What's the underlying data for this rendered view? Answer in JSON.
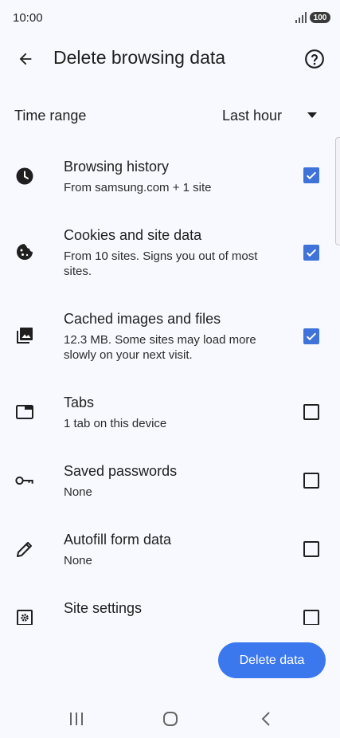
{
  "status_bar": {
    "time": "10:00",
    "battery": "100",
    "icons": [
      "signal-icon",
      "battery-icon"
    ]
  },
  "app_bar": {
    "title": "Delete browsing data",
    "icons": [
      "back-arrow-icon",
      "help-icon"
    ]
  },
  "time_range": {
    "label": "Time range",
    "value": "Last hour"
  },
  "options": [
    {
      "title": "Browsing history",
      "desc": "From samsung.com + 1 site",
      "checked": true,
      "icon": "clock-icon"
    },
    {
      "title": "Cookies and site data",
      "desc": "From 10 sites. Signs you out of most sites.",
      "checked": true,
      "icon": "cookie-icon"
    },
    {
      "title": "Cached images and files",
      "desc": "12.3 MB. Some sites may load more slowly on your next visit.",
      "checked": true,
      "icon": "images-icon"
    },
    {
      "title": "Tabs",
      "desc": "1 tab on this device",
      "checked": false,
      "icon": "tab-icon"
    },
    {
      "title": "Saved passwords",
      "desc": "None",
      "checked": false,
      "icon": "key-icon"
    },
    {
      "title": "Autofill form data",
      "desc": "None",
      "checked": false,
      "icon": "pencil-icon"
    },
    {
      "title": "Site settings",
      "desc": "",
      "checked": false,
      "icon": "site-settings-icon"
    }
  ],
  "actions": {
    "delete_label": "Delete data"
  },
  "colors": {
    "accent": "#3b78ed",
    "checkbox": "#3f73d9",
    "background": "#f8f9fe"
  }
}
